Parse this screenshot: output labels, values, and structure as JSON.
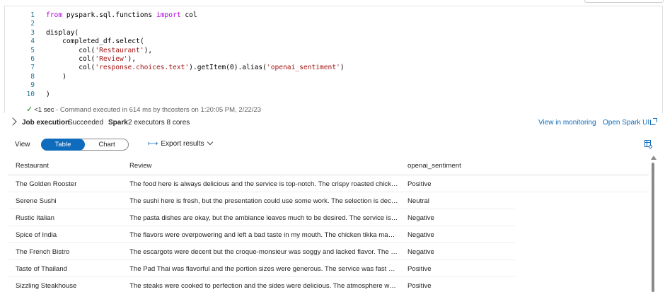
{
  "code": {
    "lines": [
      {
        "num": "1",
        "segments": [
          {
            "t": "from",
            "c": "kw"
          },
          {
            "t": " pyspark.sql.functions ",
            "c": ""
          },
          {
            "t": "import",
            "c": "kw"
          },
          {
            "t": " col",
            "c": ""
          }
        ]
      },
      {
        "num": "2",
        "segments": []
      },
      {
        "num": "3",
        "segments": [
          {
            "t": "display(",
            "c": ""
          }
        ]
      },
      {
        "num": "4",
        "segments": [
          {
            "t": "    completed_df.select(",
            "c": ""
          }
        ]
      },
      {
        "num": "5",
        "segments": [
          {
            "t": "        col(",
            "c": ""
          },
          {
            "t": "'Restaurant'",
            "c": "str"
          },
          {
            "t": "),",
            "c": ""
          }
        ]
      },
      {
        "num": "6",
        "segments": [
          {
            "t": "        col(",
            "c": ""
          },
          {
            "t": "'Review'",
            "c": "str"
          },
          {
            "t": "),",
            "c": ""
          }
        ]
      },
      {
        "num": "7",
        "segments": [
          {
            "t": "        col(",
            "c": ""
          },
          {
            "t": "'response.choices.text'",
            "c": "str"
          },
          {
            "t": ").getItem(0).alias(",
            "c": ""
          },
          {
            "t": "'openai_sentiment'",
            "c": "str"
          },
          {
            "t": ")",
            "c": ""
          }
        ]
      },
      {
        "num": "8",
        "segments": [
          {
            "t": "    )",
            "c": ""
          }
        ]
      },
      {
        "num": "9",
        "segments": []
      },
      {
        "num": "10",
        "segments": [
          {
            "t": ")",
            "c": ""
          }
        ]
      }
    ],
    "status": {
      "duration": "<1 sec",
      "message": " - Command executed in 614 ms by thcosters on 1:20:05 PM, 2/22/23"
    }
  },
  "job": {
    "label": "Job execution",
    "status": "Succeeded",
    "spark_label": "Spark",
    "spark_info": "2 executors 8 cores",
    "link_monitoring": "View in monitoring",
    "link_spark_ui": "Open Spark UI"
  },
  "toolbar": {
    "view_label": "View",
    "table_option": "Table",
    "chart_option": "Chart",
    "export_label": "Export results"
  },
  "table": {
    "headers": [
      "Restaurant",
      "Review",
      "openai_sentiment"
    ],
    "rows": [
      [
        "The Golden Rooster",
        "The food here is always delicious and the service is top-notch. The crispy roasted chicke...",
        "Positive"
      ],
      [
        "Serene Sushi",
        "The sushi here is fresh, but the presentation could use some work. The selection is decen...",
        "Neutral"
      ],
      [
        "Rustic Italian",
        "The pasta dishes are okay, but the ambiance leaves much to be desired. The service is sl...",
        "Negative"
      ],
      [
        "Spice of India",
        "The flavors were overpowering and left a bad taste in my mouth. The chicken tikka masa...",
        "Negative"
      ],
      [
        "The French Bistro",
        "The escargots were decent but the croque-monsieur was soggy and lacked flavor. The at...",
        "Negative"
      ],
      [
        "Taste of Thailand",
        "The Pad Thai was flavorful and the portion sizes were generous. The service was fast and...",
        "Positive"
      ],
      [
        "Sizzling Steakhouse",
        "The steaks were cooked to perfection and the sides were delicious. The atmosphere was ...",
        "Positive"
      ]
    ]
  },
  "colors": {
    "accent": "#0f6cbd",
    "success": "#107c10",
    "keyword": "#af00db",
    "string": "#a31515",
    "line_number": "#237893"
  }
}
